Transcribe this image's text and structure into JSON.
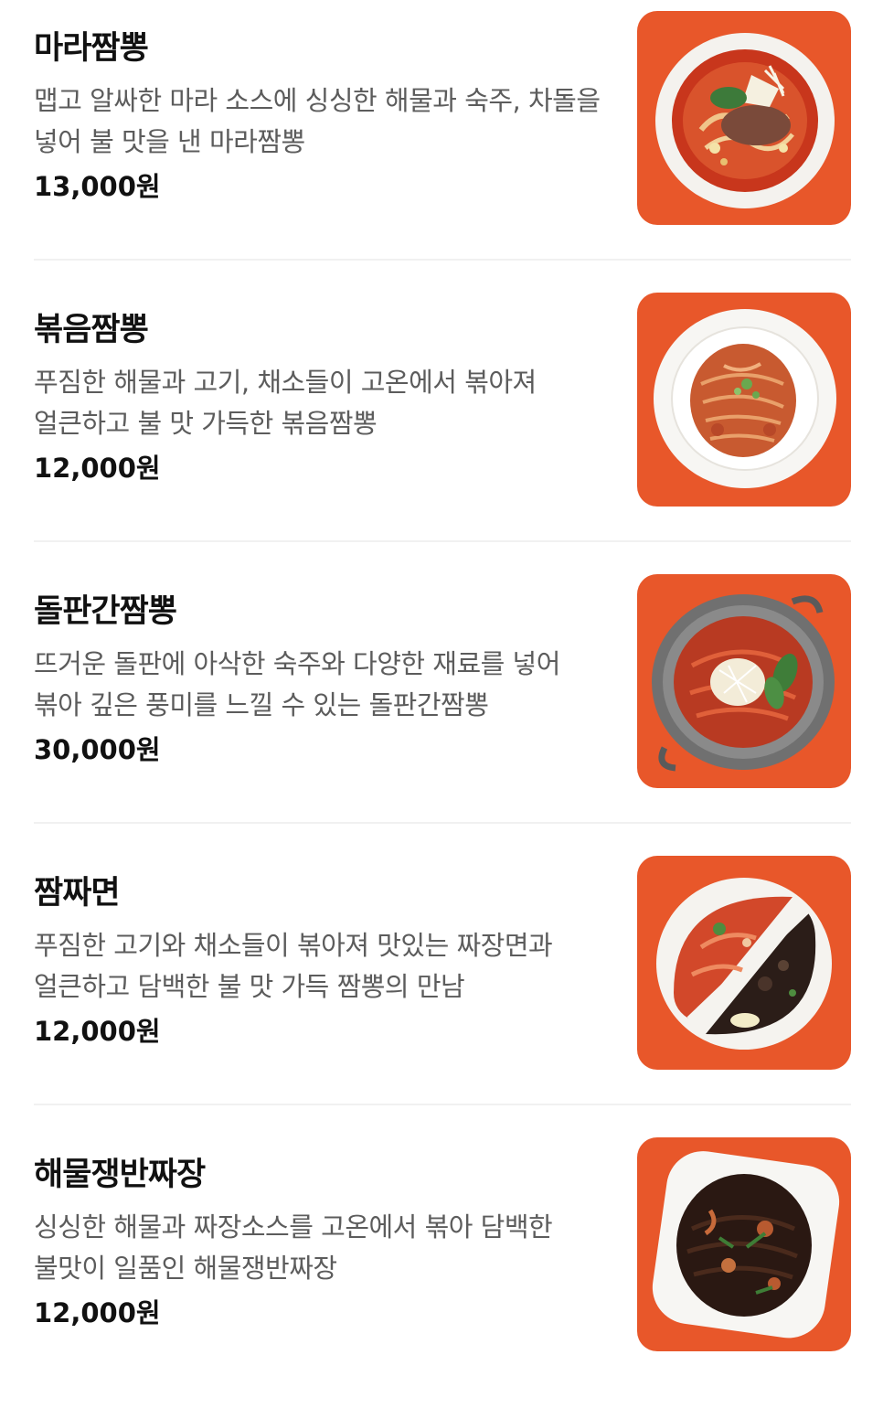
{
  "menu": {
    "items": [
      {
        "name": "마라짬뽕",
        "description": "맵고 알싸한 마라 소스에 싱싱한 해물과 숙주, 차돌을 넣어 불 맛을 낸 마라짬뽕",
        "price": "13,000원",
        "image": "mala-jjamppong-photo"
      },
      {
        "name": "볶음짬뽕",
        "description": "푸짐한 해물과 고기, 채소들이 고온에서 볶아져 얼큰하고 불 맛 가득한 볶음짬뽕",
        "price": "12,000원",
        "image": "stir-fried-jjamppong-photo"
      },
      {
        "name": "돌판간짬뽕",
        "description": "뜨거운 돌판에 아삭한 숙주와 다양한 재료를 넣어 볶아 깊은 풍미를 느낄 수 있는 돌판간짬뽕",
        "price": "30,000원",
        "image": "stone-plate-jjamppong-photo"
      },
      {
        "name": "짬짜면",
        "description": "푸짐한 고기와 채소들이 볶아져 맛있는 짜장면과 얼큰하고 담백한 불 맛 가득 짬뽕의 만남",
        "price": "12,000원",
        "image": "jjamjjamyeon-photo"
      },
      {
        "name": "해물쟁반짜장",
        "description": "싱싱한 해물과 짜장소스를 고온에서 볶아 담백한 불맛이 일품인 해물쟁반짜장",
        "price": "12,000원",
        "image": "seafood-tray-jjajang-photo"
      }
    ]
  },
  "colors": {
    "thumb_background": "#e8572a",
    "name_text": "#111111",
    "description_text": "#5c5c5c",
    "divider": "#f1f1f1"
  }
}
